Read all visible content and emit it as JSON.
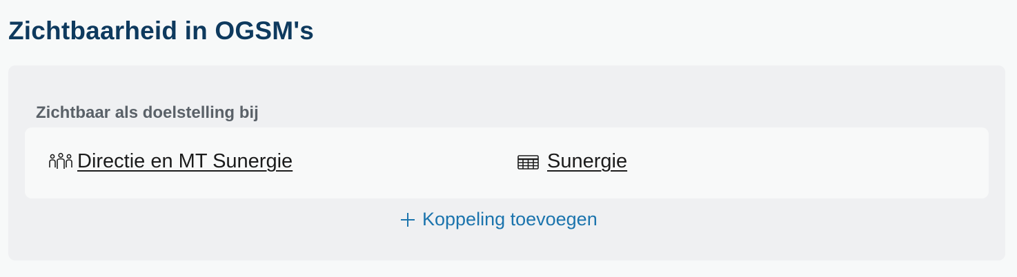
{
  "page": {
    "title": "Zichtbaarheid in OGSM's"
  },
  "section": {
    "label": "Zichtbaar als doelstelling bij"
  },
  "links": [
    {
      "icon": "team-icon",
      "label": "Directie en MT Sunergie"
    },
    {
      "icon": "table-icon",
      "label": "Sunergie"
    }
  ],
  "actions": {
    "add_label": "Koppeling toevoegen",
    "add_icon": "plus-icon"
  },
  "colors": {
    "title": "#0e3a5e",
    "accent": "#1b74ad",
    "panel": "#eff0f2",
    "card": "#f8f9f9"
  }
}
